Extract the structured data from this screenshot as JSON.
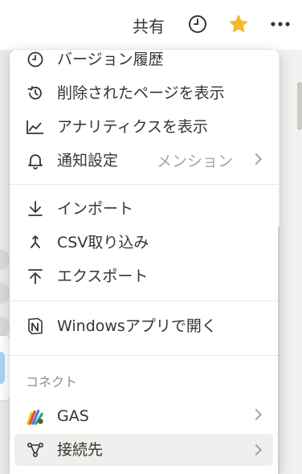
{
  "topbar": {
    "share_label": "共有",
    "icons": [
      "clock-icon",
      "star-icon",
      "more-icon"
    ],
    "star_color": "#f5b72e"
  },
  "menu": {
    "items": [
      {
        "label": "バージョン履歴",
        "icon": "clock-icon"
      },
      {
        "label": "削除されたページを表示",
        "icon": "restore-icon"
      },
      {
        "label": "アナリティクスを表示",
        "icon": "analytics-icon"
      },
      {
        "label": "通知設定",
        "sub": "メンション",
        "icon": "bell-icon"
      },
      {
        "label": "インポート",
        "icon": "import-icon"
      },
      {
        "label": "CSV取り込み",
        "icon": "merge-icon"
      },
      {
        "label": "エクスポート",
        "icon": "export-icon"
      },
      {
        "label": "Windowsアプリで開く",
        "icon": "notion-icon"
      }
    ],
    "section_label": "コネクト",
    "connect_items": [
      {
        "label": "GAS",
        "icon": "gas-logo-icon"
      },
      {
        "label": "接続先",
        "icon": "connections-icon"
      }
    ]
  }
}
